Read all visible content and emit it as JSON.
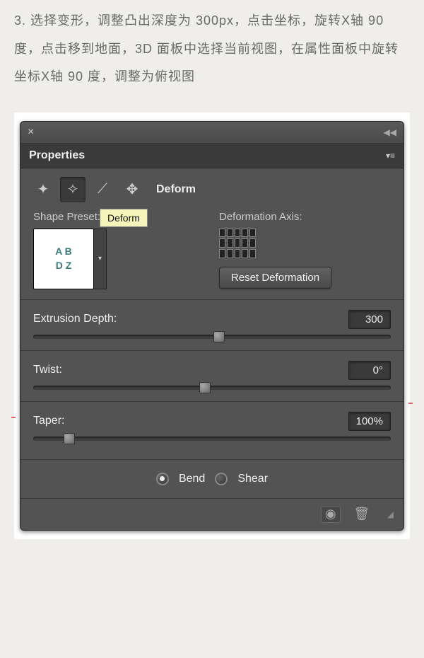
{
  "instruction": "3. 选择变形，调整凸出深度为 300px，点击坐标，旋转X轴 90 度，点击移到地面，3D 面板中选择当前视图，在属性面板中旋转坐标X轴 90 度，调整为俯视图",
  "panel": {
    "title": "Properties",
    "active_tab": "Deform",
    "tooltip": "Deform",
    "shape_preset_label": "Shape Preset:",
    "preset_text": "A B\nD Z",
    "deformation_axis_label": "Deformation Axis:",
    "reset_button": "Reset Deformation",
    "sliders": {
      "extrusion": {
        "label": "Extrusion Depth:",
        "value": "300",
        "pos": 52
      },
      "twist": {
        "label": "Twist:",
        "value": "0°",
        "pos": 48
      },
      "taper": {
        "label": "Taper:",
        "value": "100%",
        "pos": 10
      }
    },
    "radios": {
      "bend": "Bend",
      "shear": "Shear"
    }
  }
}
